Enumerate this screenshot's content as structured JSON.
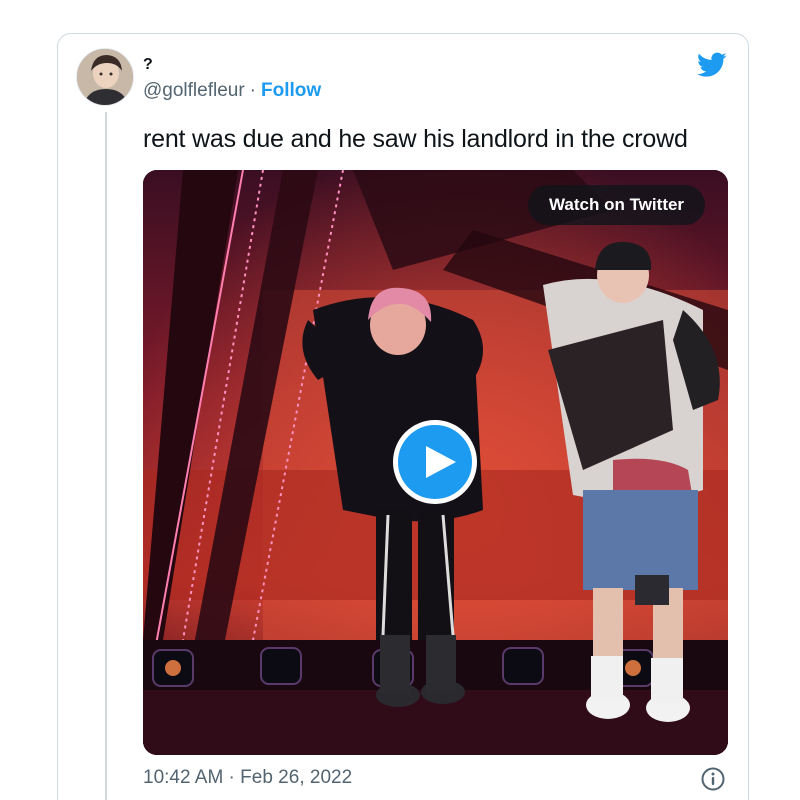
{
  "tweet": {
    "display_name": "?",
    "handle": "@golflefleur",
    "separator": "·",
    "follow_label": "Follow",
    "text": "rent was due and he saw his landlord in the crowd",
    "timestamp": "10:42 AM · Feb 26, 2022"
  },
  "media": {
    "watch_label": "Watch on Twitter"
  },
  "icons": {
    "brand": "twitter-bird-icon",
    "play": "play-icon",
    "info": "info-icon"
  },
  "colors": {
    "accent": "#1d9bf0",
    "text_primary": "#0f1419",
    "text_secondary": "#536471",
    "border": "#cfd9de"
  }
}
